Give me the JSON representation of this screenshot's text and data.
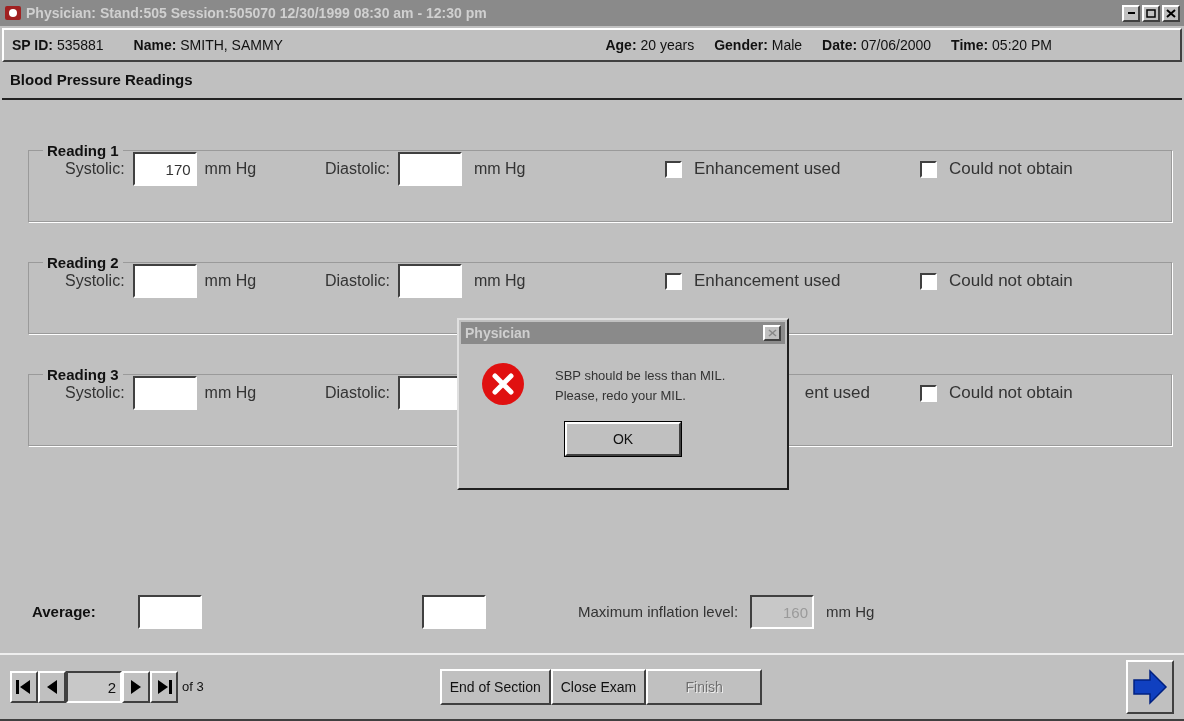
{
  "window": {
    "title": "Physician: Stand:505 Session:505070 12/30/1999 08:30 am - 12:30 pm"
  },
  "header": [
    {
      "label": "SP ID:",
      "value": "535881"
    },
    {
      "label": "Name:",
      "value": "SMITH, SAMMY"
    },
    {
      "label": "Age:",
      "value": "20 years"
    },
    {
      "label": "Gender:",
      "value": "Male"
    },
    {
      "label": "Date:",
      "value": "07/06/2000"
    },
    {
      "label": "Time:",
      "value": "05:20 PM"
    }
  ],
  "section_title": "Blood Pressure Readings",
  "readings": [
    {
      "title": "Reading 1",
      "systolic": {
        "label": "Systolic:",
        "value": "170",
        "unit": "mm Hg"
      },
      "diastolic": {
        "label": "Diastolic:",
        "unit": "mm Hg"
      },
      "enhancement": {
        "label": "Enhancement used",
        "checked": false
      },
      "could_not_obtain": {
        "label": "Could not obtain",
        "checked": false
      }
    },
    {
      "title": "Reading 2",
      "systolic": {
        "label": "Systolic:",
        "unit": "mm Hg"
      },
      "diastolic": {
        "label": "Diastolic:",
        "unit": "mm Hg"
      },
      "enhancement": {
        "label": "Enhancement used",
        "checked": false
      },
      "could_not_obtain": {
        "label": "Could not obtain",
        "checked": false
      }
    },
    {
      "title": "Reading 3",
      "systolic": {
        "label": "Systolic:",
        "unit": "mm Hg"
      },
      "diastolic": {
        "label": "Diastolic:"
      },
      "enhancement": {
        "label": "ent used"
      },
      "could_not_obtain": {
        "label": "Could not obtain",
        "checked": false
      }
    }
  ],
  "average": {
    "label": "Average:"
  },
  "max_inflation": {
    "label": "Maximum inflation level:",
    "value": "160",
    "unit": "mm Hg",
    "disabled": true
  },
  "navigator": {
    "page": "2",
    "of": "of 3"
  },
  "buttons": [
    {
      "label": "End of Section",
      "disabled": false
    },
    {
      "label": "Close Exam",
      "disabled": false
    },
    {
      "label": "Finish",
      "disabled": true
    }
  ],
  "dialog": {
    "title": "Physician",
    "message": [
      "SBP should be less than MIL.",
      "Please, redo your MIL."
    ],
    "button": "OK"
  }
}
